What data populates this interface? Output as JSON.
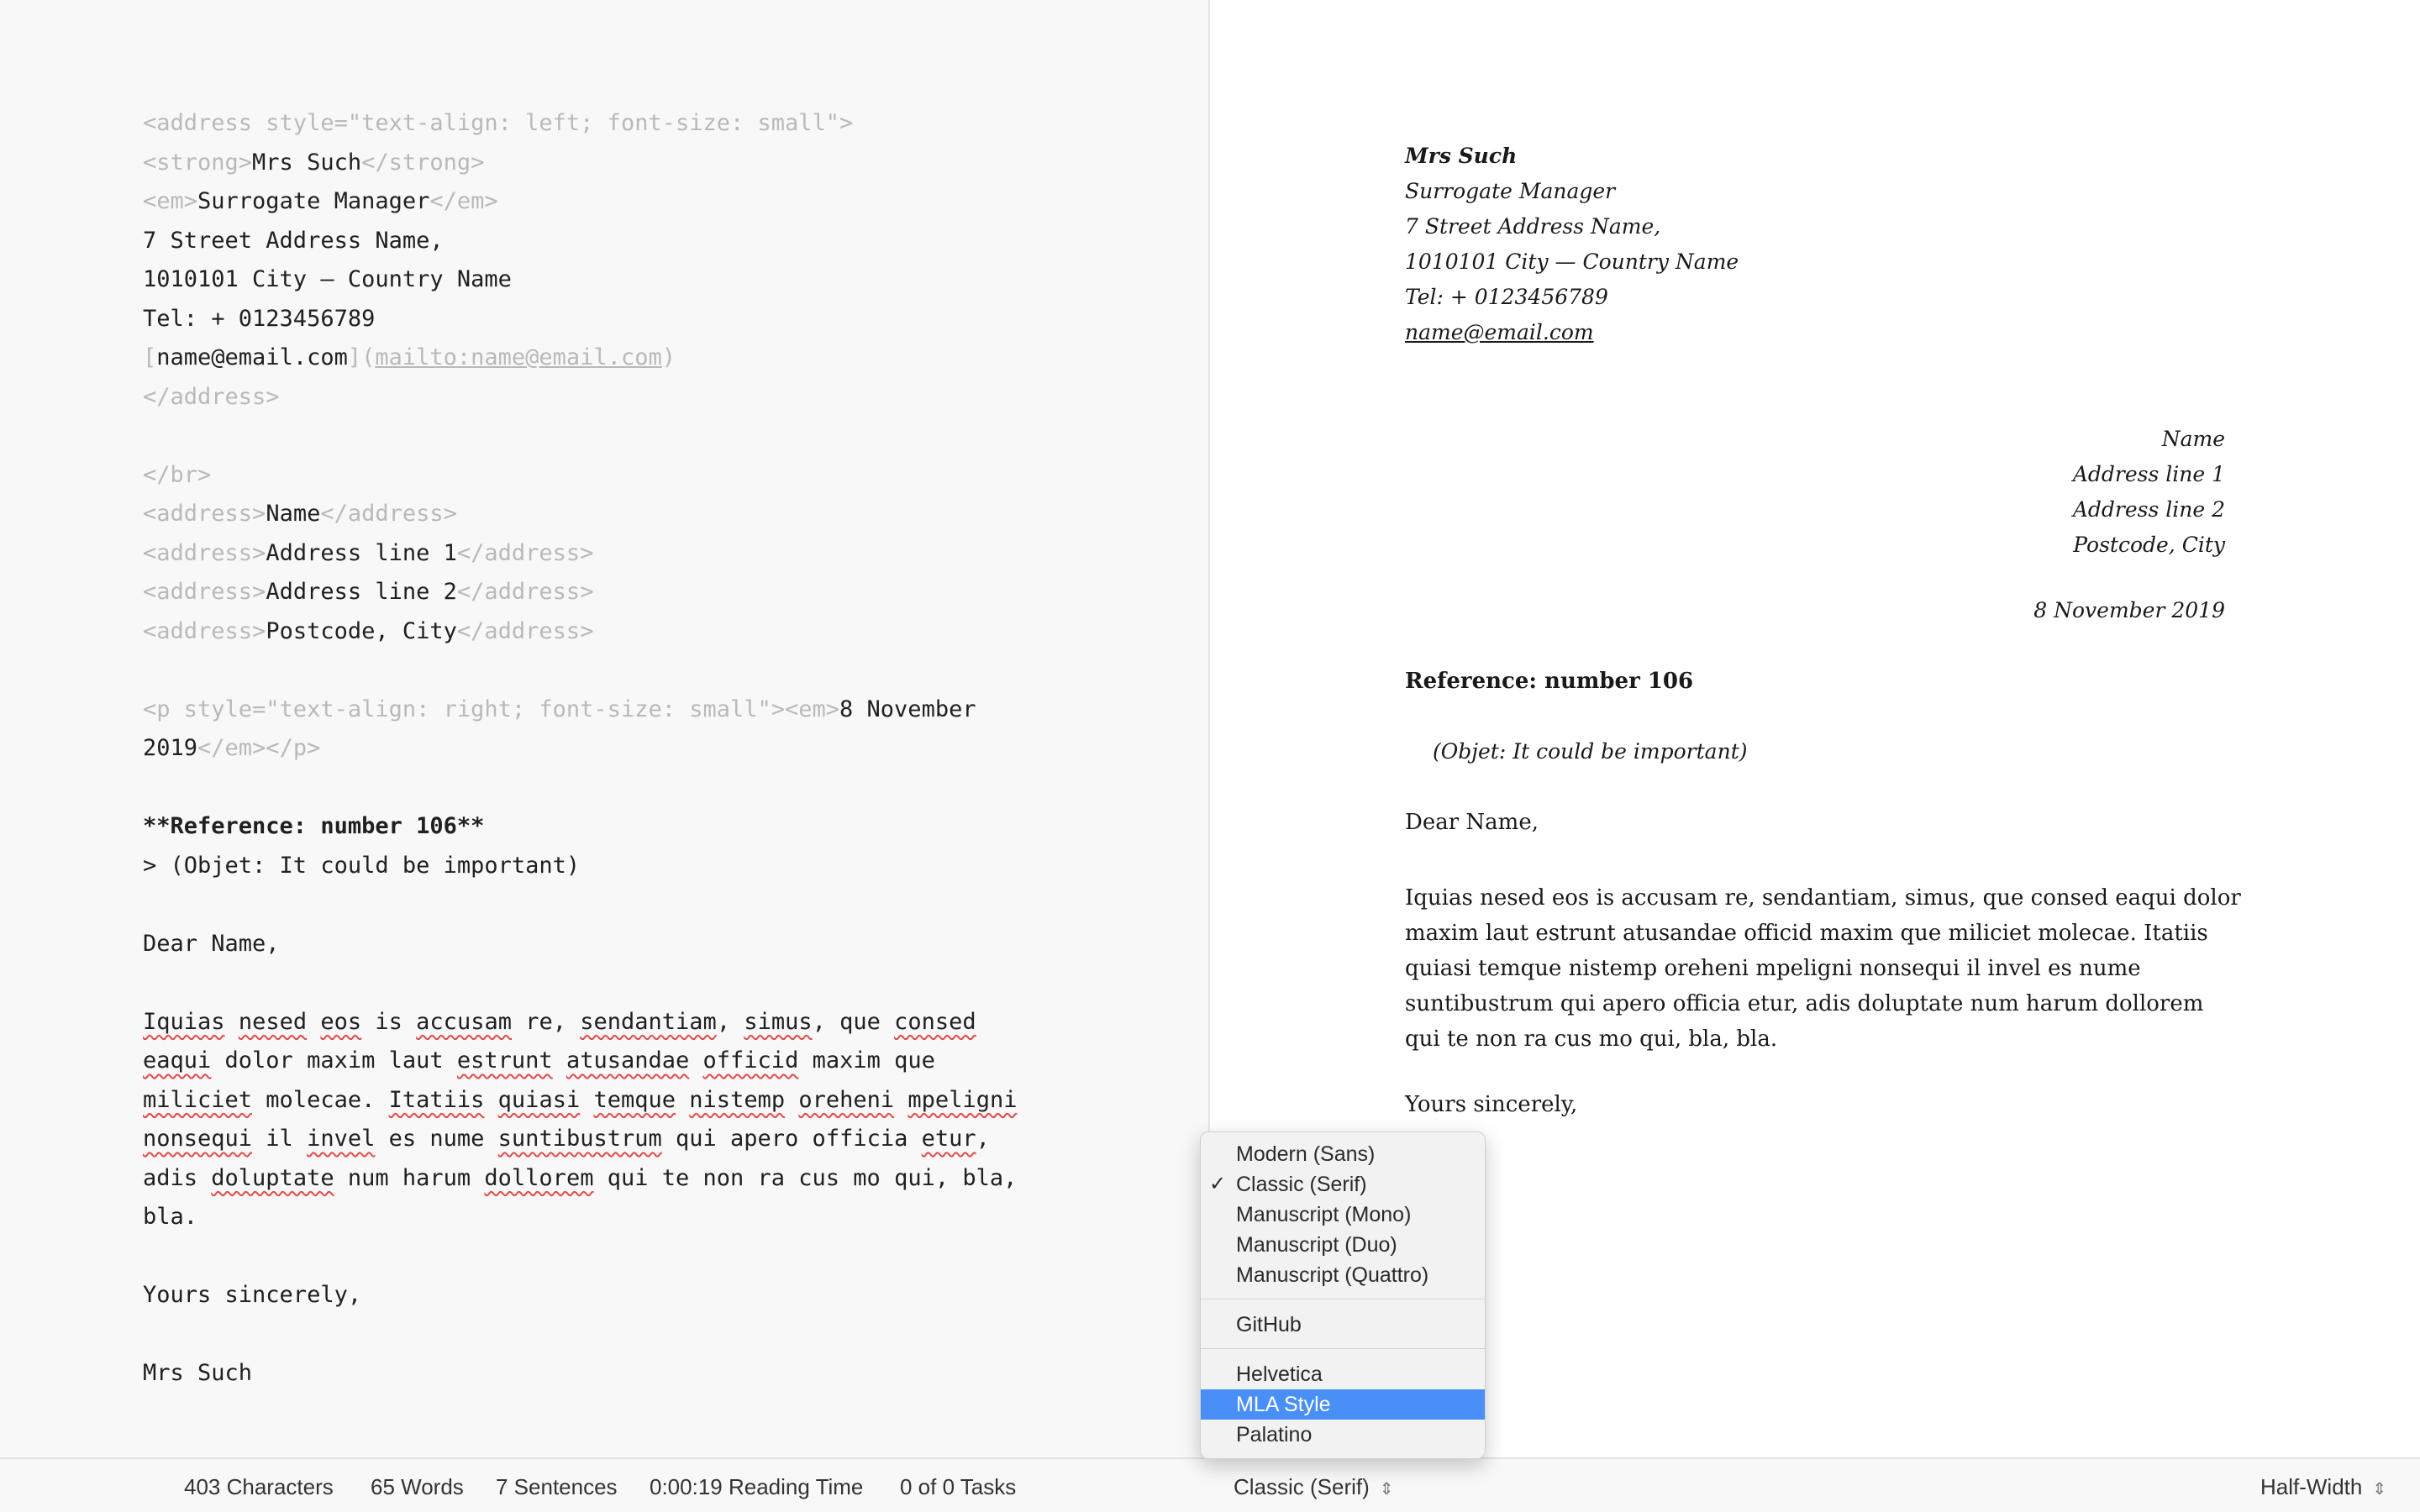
{
  "editor": {
    "lines": [
      [
        {
          "t": "<address style=\"text-align: left; font-size: small\">",
          "c": "tag"
        }
      ],
      [
        {
          "t": "<strong>",
          "c": "tag"
        },
        {
          "t": "Mrs Such"
        },
        {
          "t": "</strong>",
          "c": "tag"
        }
      ],
      [
        {
          "t": "<em>",
          "c": "tag"
        },
        {
          "t": "Surrogate Manager"
        },
        {
          "t": "</em>",
          "c": "tag"
        }
      ],
      [
        {
          "t": "7 Street Address Name,"
        }
      ],
      [
        {
          "t": "1010101 City — Country Name"
        }
      ],
      [
        {
          "t": "Tel: + 0123456789"
        }
      ],
      [
        {
          "t": "[",
          "c": "tag"
        },
        {
          "t": "name@email.com"
        },
        {
          "t": "](",
          "c": "tag"
        },
        {
          "t": "mailto:name@email.com",
          "c": "lnk"
        },
        {
          "t": ")",
          "c": "tag"
        }
      ],
      [
        {
          "t": "</address>",
          "c": "tag"
        }
      ],
      [],
      [
        {
          "t": "</br>",
          "c": "tag"
        }
      ],
      [
        {
          "t": "<address>",
          "c": "tag"
        },
        {
          "t": "Name"
        },
        {
          "t": "</address>",
          "c": "tag"
        }
      ],
      [
        {
          "t": "<address>",
          "c": "tag"
        },
        {
          "t": "Address line 1"
        },
        {
          "t": "</address>",
          "c": "tag"
        }
      ],
      [
        {
          "t": "<address>",
          "c": "tag"
        },
        {
          "t": "Address line 2"
        },
        {
          "t": "</address>",
          "c": "tag"
        }
      ],
      [
        {
          "t": "<address>",
          "c": "tag"
        },
        {
          "t": "Postcode, City"
        },
        {
          "t": "</address>",
          "c": "tag"
        }
      ],
      [],
      [
        {
          "t": "<p style=\"text-align: right; font-size: small\"><em>",
          "c": "tag"
        },
        {
          "t": "8 November"
        }
      ],
      [
        {
          "t": "2019"
        },
        {
          "t": "</em></p>",
          "c": "tag"
        }
      ],
      [],
      [
        {
          "t": "**Reference: number 106**",
          "c": "b"
        }
      ],
      [
        {
          "t": "> (Objet: It could be important)"
        }
      ],
      [],
      [
        {
          "t": "Dear Name,"
        }
      ],
      [],
      [
        {
          "t": "Iquias",
          "c": "sp"
        },
        {
          "t": " "
        },
        {
          "t": "nesed",
          "c": "sp"
        },
        {
          "t": " "
        },
        {
          "t": "eos",
          "c": "sp"
        },
        {
          "t": " is "
        },
        {
          "t": "accusam",
          "c": "sp"
        },
        {
          "t": " re, "
        },
        {
          "t": "sendantiam",
          "c": "sp"
        },
        {
          "t": ", "
        },
        {
          "t": "simus",
          "c": "sp"
        },
        {
          "t": ", que "
        },
        {
          "t": "consed",
          "c": "sp"
        }
      ],
      [
        {
          "t": "eaqui",
          "c": "sp"
        },
        {
          "t": " dolor maxim laut "
        },
        {
          "t": "estrunt",
          "c": "sp"
        },
        {
          "t": " "
        },
        {
          "t": "atusandae",
          "c": "sp"
        },
        {
          "t": " "
        },
        {
          "t": "officid",
          "c": "sp"
        },
        {
          "t": " maxim que"
        }
      ],
      [
        {
          "t": "miliciet",
          "c": "sp"
        },
        {
          "t": " molecae. "
        },
        {
          "t": "Itatiis",
          "c": "sp"
        },
        {
          "t": " "
        },
        {
          "t": "quiasi",
          "c": "sp"
        },
        {
          "t": " "
        },
        {
          "t": "temque",
          "c": "sp"
        },
        {
          "t": " "
        },
        {
          "t": "nistemp",
          "c": "sp"
        },
        {
          "t": " "
        },
        {
          "t": "oreheni",
          "c": "sp"
        },
        {
          "t": " "
        },
        {
          "t": "mpeligni",
          "c": "sp"
        }
      ],
      [
        {
          "t": "nonsequi",
          "c": "sp"
        },
        {
          "t": " il "
        },
        {
          "t": "invel",
          "c": "sp"
        },
        {
          "t": " es nume "
        },
        {
          "t": "suntibustrum",
          "c": "sp"
        },
        {
          "t": " qui apero officia "
        },
        {
          "t": "etur",
          "c": "sp"
        },
        {
          "t": ","
        }
      ],
      [
        {
          "t": "adis "
        },
        {
          "t": "doluptate",
          "c": "sp"
        },
        {
          "t": " num harum "
        },
        {
          "t": "dollorem",
          "c": "sp"
        },
        {
          "t": " qui te non ra cus mo qui, bla,"
        }
      ],
      [
        {
          "t": "bla."
        }
      ],
      [],
      [
        {
          "t": "Yours sincerely,"
        }
      ],
      [],
      [
        {
          "t": "Mrs Such"
        }
      ]
    ]
  },
  "preview": {
    "sender": {
      "name": "Mrs Such",
      "title": "Surrogate Manager",
      "street": "7 Street Address Name,",
      "city": "1010101 City — Country Name",
      "tel": "Tel: + 0123456789",
      "email": "name@email.com"
    },
    "recipient": {
      "name": "Name",
      "line1": "Address line 1",
      "line2": "Address line 2",
      "postcode": "Postcode, City"
    },
    "date": "8 November 2019",
    "reference": "Reference: number 106",
    "quote": "(Objet: It could be important)",
    "greeting": "Dear Name,",
    "body": "Iquias nesed eos is accusam re, sendantiam, simus, que consed eaqui dolor maxim laut estrunt atusandae officid maxim que miliciet molecae. Itatiis quiasi temque nistemp oreheni mpeligni nonsequi il invel es nume suntibustrum qui apero officia etur, adis doluptate num harum dollorem qui te non ra cus mo qui, bla, bla.",
    "closing": "Yours sincerely,",
    "signature_partial": "h"
  },
  "statusbar": {
    "characters": "403 Characters",
    "words": "65 Words",
    "sentences": "7 Sentences",
    "reading_time": "0:00:19 Reading Time",
    "tasks": "0 of 0 Tasks",
    "style_select": "Classic (Serif)",
    "width_select": "Half-Width"
  },
  "style_menu": {
    "groups": [
      {
        "items": [
          "Modern (Sans)",
          "Classic (Serif)",
          "Manuscript (Mono)",
          "Manuscript (Duo)",
          "Manuscript (Quattro)"
        ]
      },
      {
        "items": [
          "GitHub"
        ]
      },
      {
        "items": [
          "Helvetica",
          "MLA Style",
          "Palatino"
        ]
      }
    ],
    "checked": "Classic (Serif)",
    "highlighted": "MLA Style",
    "check_glyph": "✓"
  },
  "colors": {
    "highlight": "#4a8ff7",
    "spellcheck": "#e24a4a",
    "markup": "#b9b9b9"
  }
}
